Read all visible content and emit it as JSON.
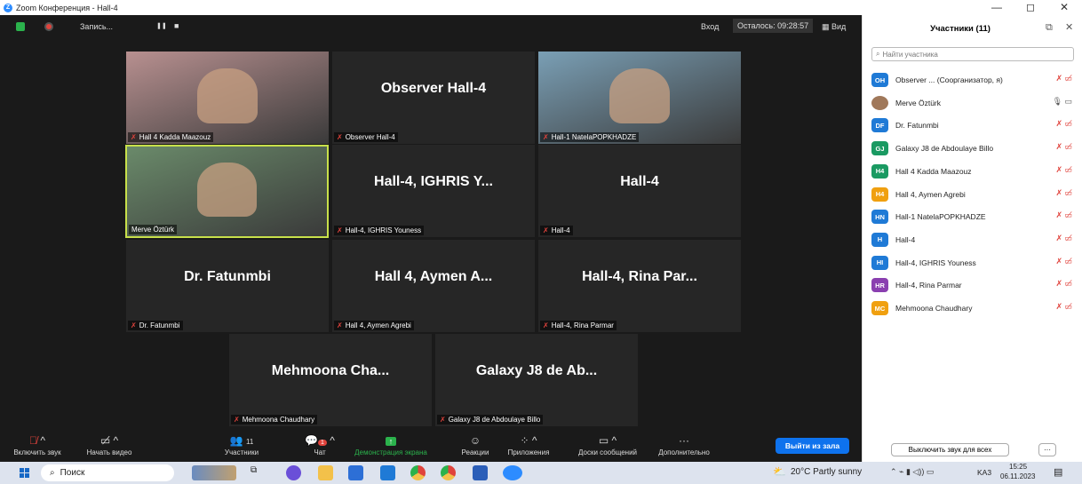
{
  "window": {
    "title": "Zoom Конференция - Hall-4",
    "minimize": "—",
    "maximize": "◻",
    "close": "✕"
  },
  "topbar": {
    "recording": "Запись...",
    "pause": "❚❚",
    "stop": "■",
    "enter": "Вход",
    "remaining": "Осталось: 09:28:57",
    "view": "Вид"
  },
  "tiles": [
    {
      "name": "Hall 4 Kadda Maazouz",
      "big": "",
      "video": true,
      "color": "#b89090"
    },
    {
      "name": "Observer Hall-4",
      "big": "Observer Hall-4",
      "video": false
    },
    {
      "name": "Hall-1 NatelaPOPKHADZE",
      "big": "",
      "video": true,
      "color": "#7a9fb5"
    },
    {
      "name": "Merve Öztürk",
      "big": "",
      "video": true,
      "color": "#6a8a6a",
      "active": true
    },
    {
      "name": "Hall-4, IGHRIS Youness",
      "big": "Hall-4, IGHRIS Y...",
      "video": false
    },
    {
      "name": "Hall-4",
      "big": "Hall-4",
      "video": false
    },
    {
      "name": "Dr. Fatunmbi",
      "big": "Dr. Fatunmbi",
      "video": false
    },
    {
      "name": "Hall 4, Aymen Agrebi",
      "big": "Hall 4, Aymen A...",
      "video": false
    },
    {
      "name": "Hall-4, Rina Parmar",
      "big": "Hall-4, Rina Par...",
      "video": false
    },
    {
      "name": "Mehmoona Chaudhary",
      "big": "Mehmoona Cha...",
      "video": false
    },
    {
      "name": "Galaxy J8 de Abdoulaye Billo",
      "big": "Galaxy J8 de Ab...",
      "video": false
    }
  ],
  "toolbar": {
    "unmute": "Включить звук",
    "video": "Начать видео",
    "participants": "Участники",
    "participants_count": "11",
    "chat": "Чат",
    "chat_badge": "1",
    "share": "Демонстрация экрана",
    "reactions": "Реакции",
    "apps": "Приложения",
    "whiteboard": "Доски сообщений",
    "more": "Дополнительно",
    "leave": "Выйти из зала"
  },
  "panel": {
    "title": "Участники (11)",
    "search_placeholder": "Найти участника",
    "mute_all": "Выключить звук для всех",
    "more": "···",
    "participants": [
      {
        "initials": "OH",
        "name": "Observer ... (Соорганизатор, я)",
        "color": "#1f7ad6"
      },
      {
        "initials": "",
        "name": "Merve Öztürk",
        "color": "#a0785a",
        "photo": true
      },
      {
        "initials": "DF",
        "name": "Dr. Fatunmbi",
        "color": "#1f7ad6"
      },
      {
        "initials": "GJ",
        "name": "Galaxy J8 de Abdoulaye Billo",
        "color": "#1a9a62"
      },
      {
        "initials": "H4",
        "name": "Hall 4 Kadda Maazouz",
        "color": "#1a9a62"
      },
      {
        "initials": "H4",
        "name": "Hall 4, Aymen Agrebi",
        "color": "#f0a010"
      },
      {
        "initials": "HN",
        "name": "Hall-1 NatelaPOPKHADZE",
        "color": "#1f7ad6"
      },
      {
        "initials": "H",
        "name": "Hall-4",
        "color": "#1f7ad6"
      },
      {
        "initials": "HI",
        "name": "Hall-4, IGHRIS Youness",
        "color": "#1f7ad6"
      },
      {
        "initials": "HR",
        "name": "Hall-4, Rina Parmar",
        "color": "#8a3fb0"
      },
      {
        "initials": "MC",
        "name": "Mehmoona Chaudhary",
        "color": "#f0a010"
      }
    ]
  },
  "taskbar": {
    "search": "Поиск",
    "weather": "20°C Partly sunny",
    "lang": "KA3",
    "time": "15:25",
    "date": "06.11.2023"
  }
}
